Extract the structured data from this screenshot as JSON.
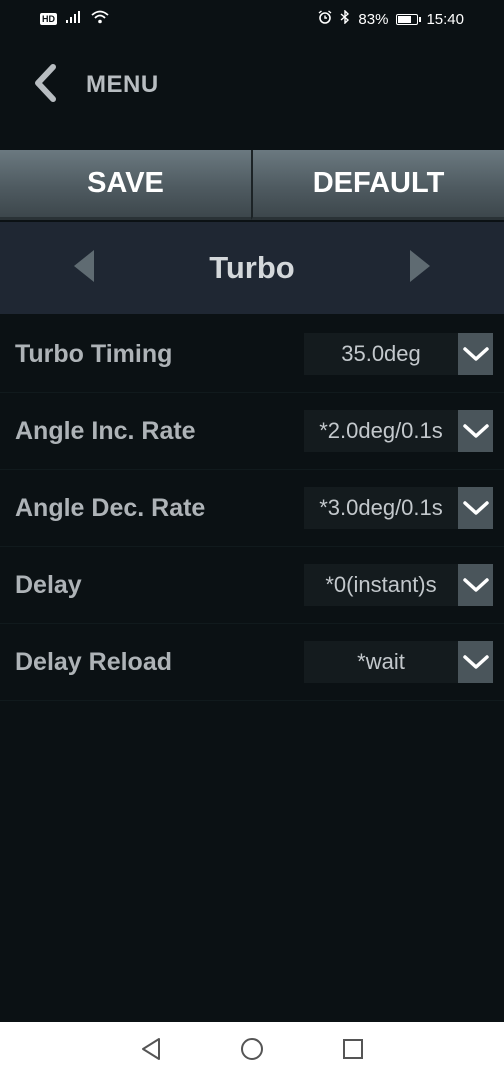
{
  "status_bar": {
    "hd": "HD",
    "battery_percent": "83%",
    "battery_level": 0.83,
    "time": "15:40",
    "icons": [
      "signal-icon",
      "wifi-icon",
      "alarm-icon",
      "bluetooth-icon",
      "battery-icon"
    ]
  },
  "header": {
    "title": "MENU",
    "back_icon": "chevron-left-icon"
  },
  "actions": {
    "save_label": "SAVE",
    "default_label": "DEFAULT"
  },
  "section": {
    "title": "Turbo",
    "prev_icon": "triangle-left-icon",
    "next_icon": "triangle-right-icon"
  },
  "settings": [
    {
      "label": "Turbo Timing",
      "value": "35.0deg"
    },
    {
      "label": "Angle Inc. Rate",
      "value": "*2.0deg/0.1s"
    },
    {
      "label": "Angle Dec. Rate",
      "value": "*3.0deg/0.1s"
    },
    {
      "label": "Delay",
      "value": "*0(instant)s"
    },
    {
      "label": "Delay Reload",
      "value": "*wait"
    }
  ],
  "system_nav": {
    "icons": [
      "back-triangle-icon",
      "home-circle-icon",
      "recents-square-icon"
    ]
  },
  "colors": {
    "background": "#0b1114",
    "section_bar": "#1f2733",
    "button_gray": "#4f5b61",
    "dropdown_bg": "#4a555b"
  }
}
